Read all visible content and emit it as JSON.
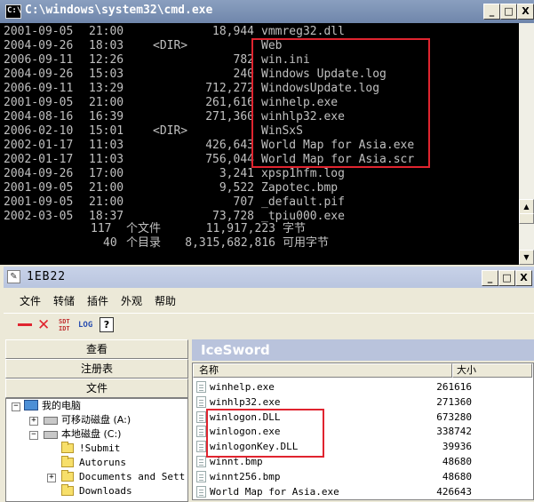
{
  "cmd": {
    "title": "C:\\windows\\system32\\cmd.exe",
    "title_icon": "C:\\",
    "controls": [
      "_",
      "□",
      "X"
    ],
    "lines": [
      {
        "date": "2001-09-05",
        "time": "21:00",
        "dir": "",
        "size": "18,944",
        "name": "vmmreg32.dll"
      },
      {
        "date": "2004-09-26",
        "time": "18:03",
        "dir": "<DIR>",
        "size": "",
        "name": "Web"
      },
      {
        "date": "2006-09-11",
        "time": "12:26",
        "dir": "",
        "size": "782",
        "name": "win.ini"
      },
      {
        "date": "2004-09-26",
        "time": "15:03",
        "dir": "",
        "size": "240",
        "name": "Windows Update.log"
      },
      {
        "date": "2006-09-11",
        "time": "13:29",
        "dir": "",
        "size": "712,272",
        "name": "WindowsUpdate.log"
      },
      {
        "date": "2001-09-05",
        "time": "21:00",
        "dir": "",
        "size": "261,616",
        "name": "winhelp.exe"
      },
      {
        "date": "2004-08-16",
        "time": "16:39",
        "dir": "",
        "size": "271,360",
        "name": "winhlp32.exe"
      },
      {
        "date": "2006-02-10",
        "time": "15:01",
        "dir": "<DIR>",
        "size": "",
        "name": "WinSxS"
      },
      {
        "date": "2002-01-17",
        "time": "11:03",
        "dir": "",
        "size": "426,643",
        "name": "World Map for Asia.exe"
      },
      {
        "date": "2002-01-17",
        "time": "11:03",
        "dir": "",
        "size": "756,044",
        "name": "World Map for Asia.scr"
      },
      {
        "date": "2004-09-26",
        "time": "17:00",
        "dir": "",
        "size": "3,241",
        "name": "xpsp1hfm.log"
      },
      {
        "date": "2001-09-05",
        "time": "21:00",
        "dir": "",
        "size": "9,522",
        "name": "Zapotec.bmp"
      },
      {
        "date": "2001-09-05",
        "time": "21:00",
        "dir": "",
        "size": "707",
        "name": "_default.pif"
      },
      {
        "date": "2002-03-05",
        "time": "18:37",
        "dir": "",
        "size": "73,728",
        "name": "_tpiu000.exe"
      }
    ],
    "summary": [
      {
        "count": "117",
        "label": "个文件",
        "size": "11,917,223",
        "unit": "字节"
      },
      {
        "count": "40",
        "label": "个目录",
        "size": "8,315,682,816",
        "unit": "可用字节"
      }
    ]
  },
  "ice": {
    "title": "1EB22",
    "controls": [
      "_",
      "□",
      "X"
    ],
    "menu": [
      "文件",
      "转储",
      "插件",
      "外观",
      "帮助"
    ],
    "toolbar": {
      "sdt_top": "SDT",
      "sdt_bottom": "IDT",
      "log": "LOG",
      "help": "?"
    },
    "tabs": [
      "查看",
      "注册表",
      "文件"
    ],
    "header": "IceSword",
    "columns": {
      "name": "名称",
      "size": "大小"
    },
    "tree": [
      {
        "label": "我的电脑",
        "kind": "pc",
        "expander": "−"
      },
      {
        "label": "可移动磁盘 (A:)",
        "kind": "drive",
        "expander": "+"
      },
      {
        "label": "本地磁盘 (C:)",
        "kind": "drive",
        "expander": "−"
      },
      {
        "label": "!Submit",
        "kind": "folder",
        "expander": ""
      },
      {
        "label": "Autoruns",
        "kind": "folder",
        "expander": ""
      },
      {
        "label": "Documents and Sett",
        "kind": "folder",
        "expander": "+"
      },
      {
        "label": "Downloads",
        "kind": "folder",
        "expander": ""
      }
    ],
    "files": [
      {
        "name": "winhelp.exe",
        "size": "261616"
      },
      {
        "name": "winhlp32.exe",
        "size": "271360"
      },
      {
        "name": "winlogon.DLL",
        "size": "673280"
      },
      {
        "name": "winlogon.exe",
        "size": "338742"
      },
      {
        "name": "winlogonKey.DLL",
        "size": "39936"
      },
      {
        "name": "winnt.bmp",
        "size": "48680"
      },
      {
        "name": "winnt256.bmp",
        "size": "48680"
      },
      {
        "name": "World Map for Asia.exe",
        "size": "426643"
      }
    ]
  },
  "colors": {
    "highlight": "#e0242f",
    "cmd_bg": "#000000",
    "cmd_text": "#c0c0c0"
  }
}
